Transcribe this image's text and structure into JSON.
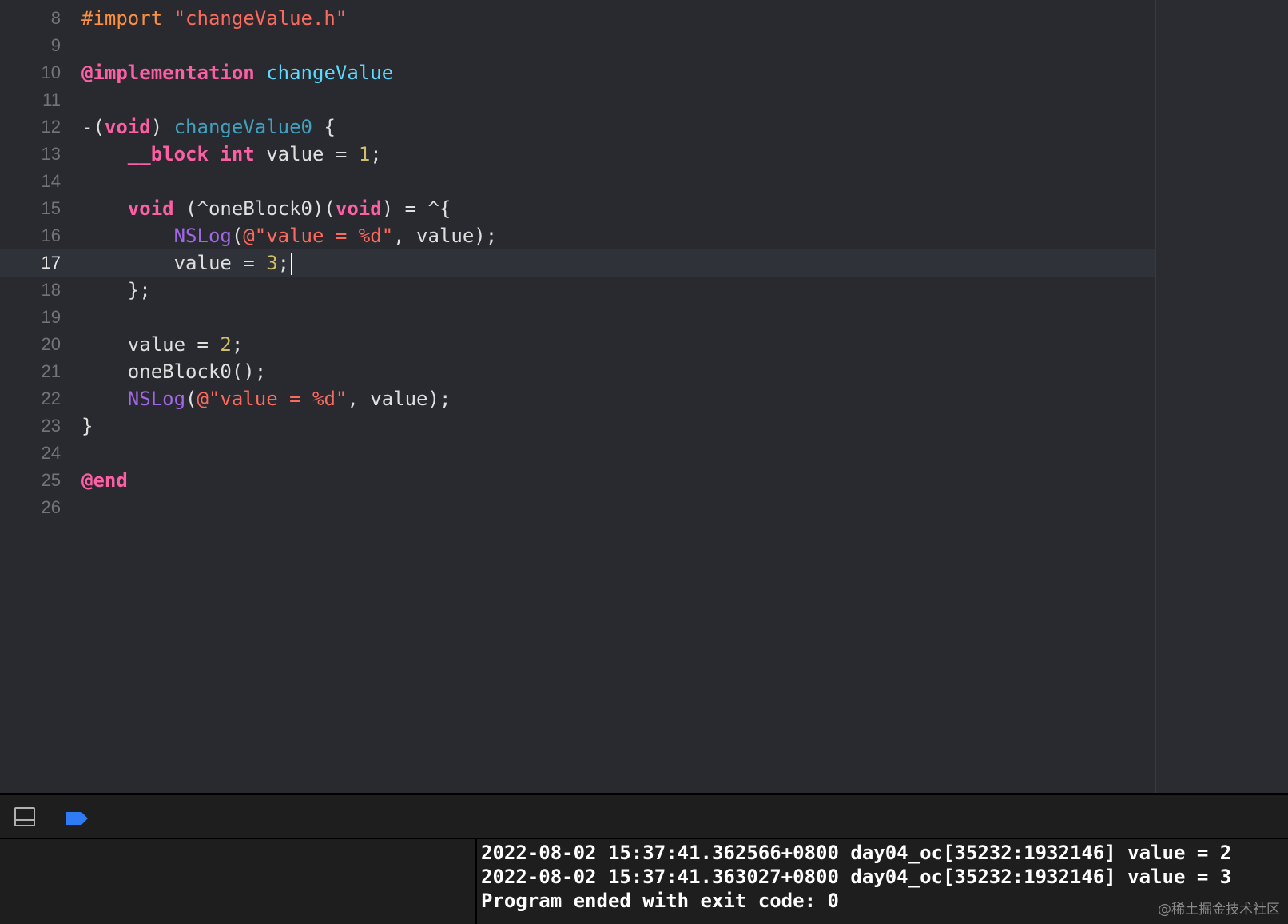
{
  "editor": {
    "current_line": 17,
    "lines": [
      {
        "num": "8",
        "tokens": [
          {
            "t": "#import ",
            "c": "pp"
          },
          {
            "t": "\"changeValue.h\"",
            "c": "str"
          }
        ]
      },
      {
        "num": "9",
        "tokens": []
      },
      {
        "num": "10",
        "tokens": [
          {
            "t": "@implementation",
            "c": "kw"
          },
          {
            "t": " ",
            "c": "pl"
          },
          {
            "t": "changeValue",
            "c": "cls"
          }
        ]
      },
      {
        "num": "11",
        "tokens": []
      },
      {
        "num": "12",
        "tokens": [
          {
            "t": "-(",
            "c": "pl"
          },
          {
            "t": "void",
            "c": "kw"
          },
          {
            "t": ") ",
            "c": "pl"
          },
          {
            "t": "changeValue0",
            "c": "fn"
          },
          {
            "t": " {",
            "c": "pl"
          }
        ]
      },
      {
        "num": "13",
        "tokens": [
          {
            "t": "    ",
            "c": "pl"
          },
          {
            "t": "__block",
            "c": "kw"
          },
          {
            "t": " ",
            "c": "pl"
          },
          {
            "t": "int",
            "c": "kw"
          },
          {
            "t": " value = ",
            "c": "pl"
          },
          {
            "t": "1",
            "c": "num"
          },
          {
            "t": ";",
            "c": "pl"
          }
        ]
      },
      {
        "num": "14",
        "tokens": []
      },
      {
        "num": "15",
        "tokens": [
          {
            "t": "    ",
            "c": "pl"
          },
          {
            "t": "void",
            "c": "kw"
          },
          {
            "t": " (^oneBlock0)(",
            "c": "pl"
          },
          {
            "t": "void",
            "c": "kw"
          },
          {
            "t": ") = ^{",
            "c": "pl"
          }
        ]
      },
      {
        "num": "16",
        "tokens": [
          {
            "t": "        ",
            "c": "pl"
          },
          {
            "t": "NSLog",
            "c": "api"
          },
          {
            "t": "(",
            "c": "pl"
          },
          {
            "t": "@\"value = %d\"",
            "c": "str"
          },
          {
            "t": ", value);",
            "c": "pl"
          }
        ]
      },
      {
        "num": "17",
        "tokens": [
          {
            "t": "        value = ",
            "c": "pl"
          },
          {
            "t": "3",
            "c": "num"
          },
          {
            "t": ";",
            "c": "pl"
          }
        ]
      },
      {
        "num": "18",
        "tokens": [
          {
            "t": "    };",
            "c": "pl"
          }
        ]
      },
      {
        "num": "19",
        "tokens": []
      },
      {
        "num": "20",
        "tokens": [
          {
            "t": "    value = ",
            "c": "pl"
          },
          {
            "t": "2",
            "c": "num"
          },
          {
            "t": ";",
            "c": "pl"
          }
        ]
      },
      {
        "num": "21",
        "tokens": [
          {
            "t": "    oneBlock0();",
            "c": "pl"
          }
        ]
      },
      {
        "num": "22",
        "tokens": [
          {
            "t": "    ",
            "c": "pl"
          },
          {
            "t": "NSLog",
            "c": "api"
          },
          {
            "t": "(",
            "c": "pl"
          },
          {
            "t": "@\"value = %d\"",
            "c": "str"
          },
          {
            "t": ", value);",
            "c": "pl"
          }
        ]
      },
      {
        "num": "23",
        "tokens": [
          {
            "t": "}",
            "c": "pl"
          }
        ]
      },
      {
        "num": "24",
        "tokens": []
      },
      {
        "num": "25",
        "tokens": [
          {
            "t": "@end",
            "c": "kw"
          }
        ]
      },
      {
        "num": "26",
        "tokens": []
      }
    ]
  },
  "debug_bar": {
    "breakpoint_color": "#2f7bf5"
  },
  "console": {
    "lines": [
      "2022-08-02 15:37:41.362566+0800 day04_oc[35232:1932146] value = 2",
      "2022-08-02 15:37:41.363027+0800 day04_oc[35232:1932146] value = 3",
      "Program ended with exit code: 0"
    ]
  },
  "watermark": "@稀土掘金技术社区",
  "colors": {
    "editor_bg": "#292a30",
    "keyword": "#fc5fa3",
    "preprocessor": "#fd8f3f",
    "class_name": "#5dd8ff",
    "method_name": "#41a1c0",
    "api": "#a167e6",
    "string": "#fc6a5d",
    "number": "#d0bf69"
  }
}
